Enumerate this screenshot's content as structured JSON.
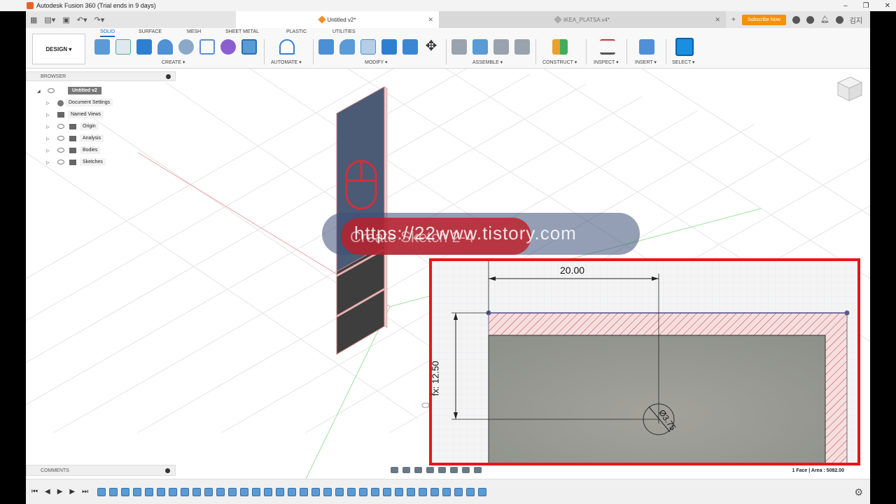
{
  "window": {
    "title": "Autodesk Fusion 360 (Trial ends in 9 days)"
  },
  "tabs": [
    {
      "label": "Untitled v2*",
      "active": true
    },
    {
      "label": "IKEA_PLATSA v4*",
      "active": false
    }
  ],
  "header": {
    "subscribe_label": "Subscribe Now",
    "user": "김지"
  },
  "ribbon": {
    "workspace_label": "DESIGN ▾",
    "tabs": [
      "SOLID",
      "SURFACE",
      "MESH",
      "SHEET METAL",
      "PLASTIC",
      "UTILITIES"
    ],
    "groups": [
      "CREATE ▾",
      "AUTOMATE ▾",
      "MODIFY ▾",
      "ASSEMBLE ▾",
      "CONSTRUCT ▾",
      "INSPECT ▾",
      "INSERT ▾",
      "SELECT ▾"
    ]
  },
  "browser": {
    "title": "BROWSER",
    "root": "Untitled v2",
    "items": [
      "Document Settings",
      "Named Views",
      "Origin",
      "Analysis",
      "Bodies",
      "Sketches"
    ]
  },
  "comments": {
    "title": "COMMENTS"
  },
  "overlay": {
    "caption": "Create Sketch 2-4",
    "watermark": "https://22www.tistory.com"
  },
  "inset": {
    "width_dim": "20.00",
    "height_dim": "fx: 12.50",
    "diameter_dim": "Ø3.75"
  },
  "status": {
    "text": "1 Face | Area : 5082.00"
  },
  "colors": {
    "accent": "#1a6fc7",
    "subscribe": "#f5900a",
    "highlight": "#e8141c"
  }
}
